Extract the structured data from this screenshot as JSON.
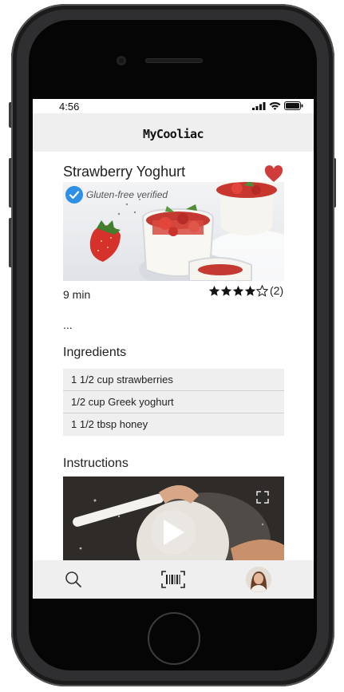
{
  "status_bar": {
    "time": "4:56"
  },
  "header": {
    "app_title": "MyCooliac"
  },
  "recipe": {
    "title": "Strawberry Yoghurt",
    "badge": "Gluten-free verified",
    "cook_time": "9 min",
    "rating_stars": 4,
    "rating_max": 5,
    "rating_count": "(2)",
    "description": "...",
    "favorite": true
  },
  "ingredients": {
    "heading": "Ingredients",
    "items": [
      "1 1/2 cup strawberries",
      "1/2 cup Greek yoghurt",
      "1 1/2 tbsp honey"
    ]
  },
  "instructions": {
    "heading": "Instructions"
  },
  "tabbar": {
    "items": [
      "search-icon",
      "barcode-icon",
      "profile-avatar"
    ]
  },
  "colors": {
    "favorite": "#d03c3c",
    "badge": "#2d8fe6",
    "header_bg": "#efefef"
  }
}
